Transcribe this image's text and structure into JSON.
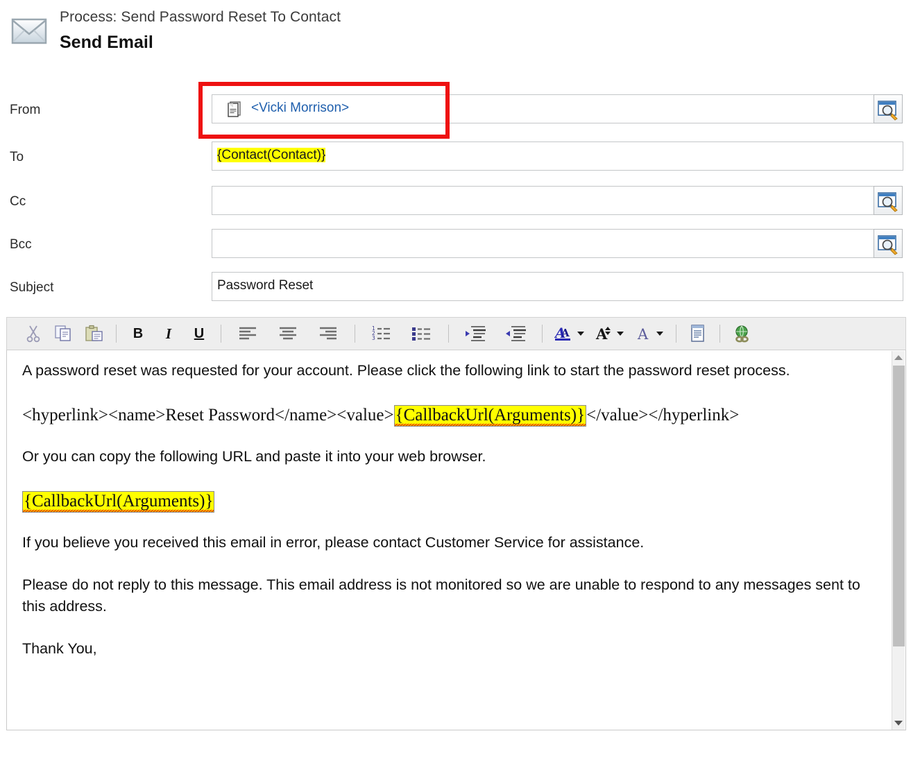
{
  "header": {
    "process_label": "Process: Send Password Reset To Contact",
    "form_title": "Send Email",
    "icon": "envelope-icon"
  },
  "fields": {
    "from": {
      "label": "From",
      "value": "<Vicki Morrison>",
      "value_color": "#1f5fad",
      "icon": "record-lookup-icon",
      "lookup_icon": "lookup-magnifier-icon",
      "has_lookup": true
    },
    "to": {
      "label": "To",
      "value": "{Contact(Contact)}",
      "highlight_color": "#ffff00",
      "has_lookup": false
    },
    "cc": {
      "label": "Cc",
      "value": "",
      "lookup_icon": "lookup-magnifier-icon",
      "has_lookup": true
    },
    "bcc": {
      "label": "Bcc",
      "value": "",
      "lookup_icon": "lookup-magnifier-icon",
      "has_lookup": true
    },
    "subject": {
      "label": "Subject",
      "value": "Password Reset",
      "has_lookup": false
    }
  },
  "annotation": {
    "type": "highlight-rectangle",
    "color": "#ee1111",
    "targets": "from-field"
  },
  "toolbar": {
    "buttons": [
      {
        "name": "cut-icon",
        "label": "Cut",
        "glyph": "scissors"
      },
      {
        "name": "copy-icon",
        "label": "Copy",
        "glyph": "copy"
      },
      {
        "name": "paste-icon",
        "label": "Paste",
        "glyph": "paste"
      },
      {
        "name": "bold-icon",
        "label": "B",
        "glyph": "text"
      },
      {
        "name": "italic-icon",
        "label": "I",
        "glyph": "text"
      },
      {
        "name": "underline-icon",
        "label": "U",
        "glyph": "text"
      },
      {
        "name": "align-left-icon",
        "label": "Align Left",
        "glyph": "lines"
      },
      {
        "name": "align-center-icon",
        "label": "Align Center",
        "glyph": "lines"
      },
      {
        "name": "align-right-icon",
        "label": "Align Right",
        "glyph": "lines"
      },
      {
        "name": "numbered-list-icon",
        "label": "Numbered List",
        "glyph": "list"
      },
      {
        "name": "bulleted-list-icon",
        "label": "Bulleted List",
        "glyph": "list"
      },
      {
        "name": "increase-indent-icon",
        "label": "Increase Indent",
        "glyph": "indent"
      },
      {
        "name": "decrease-indent-icon",
        "label": "Decrease Indent",
        "glyph": "indent"
      },
      {
        "name": "font-color-icon",
        "label": "A",
        "glyph": "font"
      },
      {
        "name": "font-size-icon",
        "label": "A",
        "glyph": "font"
      },
      {
        "name": "font-name-icon",
        "label": "A",
        "glyph": "font"
      },
      {
        "name": "source-view-icon",
        "label": "Source",
        "glyph": "page"
      },
      {
        "name": "insert-link-icon",
        "label": "Insert Link",
        "glyph": "globe-link"
      }
    ]
  },
  "body": {
    "paragraphs": [
      {
        "style": "sans",
        "segments": [
          {
            "text": "A password reset was requested for your account. Please click the following link to start the password reset process.",
            "highlight": false
          }
        ]
      },
      {
        "style": "serif",
        "segments": [
          {
            "text": "<hyperlink><name>Reset Password</name><value>",
            "highlight": false
          },
          {
            "text": "{CallbackUrl(Arguments)}",
            "highlight": true,
            "spellcheck_error": true
          },
          {
            "text": "</value></hyperlink>",
            "highlight": false
          }
        ]
      },
      {
        "style": "sans",
        "segments": [
          {
            "text": "Or you can copy the following URL and paste it into your web browser.",
            "highlight": false
          }
        ]
      },
      {
        "style": "serif",
        "segments": [
          {
            "text": "{CallbackUrl(Arguments)}",
            "highlight": true,
            "spellcheck_error": true
          }
        ]
      },
      {
        "style": "sans",
        "segments": [
          {
            "text": "If you believe you received this email in error, please contact Customer Service for assistance.",
            "highlight": false
          }
        ]
      },
      {
        "style": "sans",
        "segments": [
          {
            "text": "Please do not reply to this message. This email address is not monitored so we are unable to respond to any messages sent to this address.",
            "highlight": false
          }
        ]
      },
      {
        "style": "sans",
        "segments": [
          {
            "text": "Thank You,",
            "highlight": false
          }
        ]
      }
    ],
    "highlight_color": "#ffff00",
    "spell_error_color": "#e00000"
  },
  "scrollbar": {
    "up_arrow": "scroll-up-arrow-icon",
    "down_arrow": "scroll-down-arrow-icon",
    "thumb_position_pct": 0,
    "thumb_size_pct": 77
  }
}
